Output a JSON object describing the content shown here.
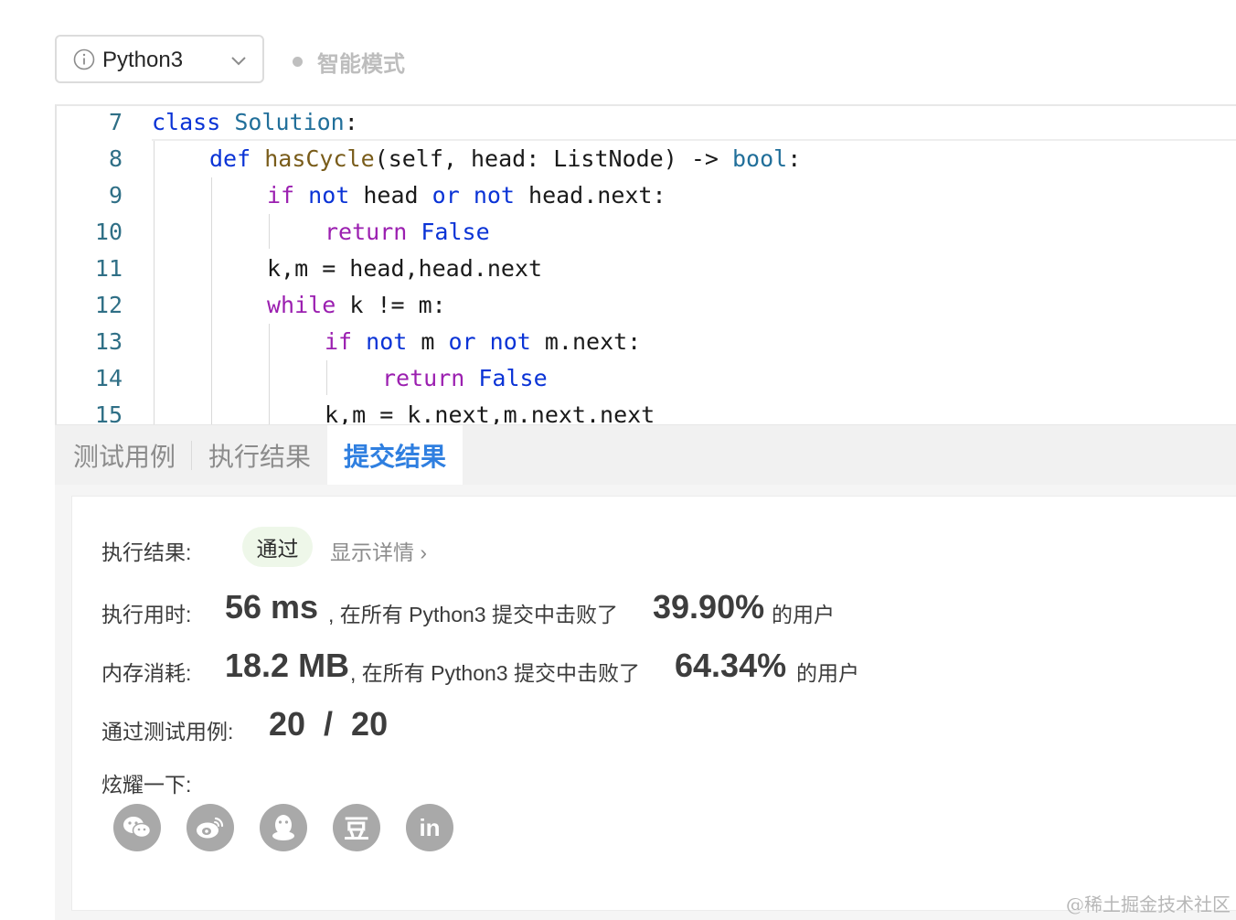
{
  "toolbar": {
    "language": "Python3",
    "mode_label": "智能模式",
    "info_icon": "info-circle-icon",
    "dropdown_icon": "chevron-down-icon"
  },
  "editor": {
    "lines": [
      {
        "no": "7"
      },
      {
        "no": "8"
      },
      {
        "no": "9"
      },
      {
        "no": "10"
      },
      {
        "no": "11"
      },
      {
        "no": "12"
      },
      {
        "no": "13"
      },
      {
        "no": "14"
      },
      {
        "no": "15"
      }
    ],
    "code": {
      "l7_kw": "class",
      "l7_name": "Solution",
      "l7_rest": ":",
      "l8_kw": "def",
      "l8_fn": "hasCycle",
      "l8_args": "(self, head: ListNode) -> ",
      "l8_type": "bool",
      "l8_end": ":",
      "l9_if": "if",
      "l9_not1": "not",
      "l9_head": " head ",
      "l9_or": "or",
      "l9_not2": "not",
      "l9_rest": " head.next:",
      "l10_ret": "return",
      "l10_false": "False",
      "l11": "k,m = head,head.next",
      "l12_while": "while",
      "l12_rest": " k != m:",
      "l13_if": "if",
      "l13_not1": "not",
      "l13_m": " m ",
      "l13_or": "or",
      "l13_not2": "not",
      "l13_rest": " m.next:",
      "l14_ret": "return",
      "l14_false": "False",
      "l15": "k,m = k.next,m.next.next"
    }
  },
  "tabs": [
    {
      "label": "测试用例"
    },
    {
      "label": "执行结果"
    },
    {
      "label": "提交结果"
    }
  ],
  "result": {
    "status_label": "执行结果:",
    "status_value": "通过",
    "detail_link": "显示详情 ›",
    "runtime_label": "执行用时:",
    "runtime_value": "56 ms",
    "runtime_text": ", 在所有 Python3 提交中击败了",
    "runtime_percent": "39.90%",
    "runtime_suffix": "的用户",
    "memory_label": "内存消耗:",
    "memory_value": "18.2 MB",
    "memory_text": ", 在所有 Python3 提交中击败了",
    "memory_percent": "64.34%",
    "memory_suffix": "的用户",
    "cases_label": "通过测试用例:",
    "cases_value": "20  /  20",
    "share_label": "炫耀一下:",
    "share_icons": [
      "wechat-icon",
      "weibo-icon",
      "qq-icon",
      "douban-icon",
      "linkedin-icon"
    ],
    "douban_glyph": "豆",
    "linkedin_glyph": "in"
  },
  "watermark": "@稀土掘金技术社区",
  "colors": {
    "active_tab": "#2f7fe0",
    "pass_badge_bg": "#eef7e9",
    "keyword_blue": "#0a33d6",
    "keyword_purple": "#9b1fb0",
    "line_number": "#2f6f86"
  }
}
